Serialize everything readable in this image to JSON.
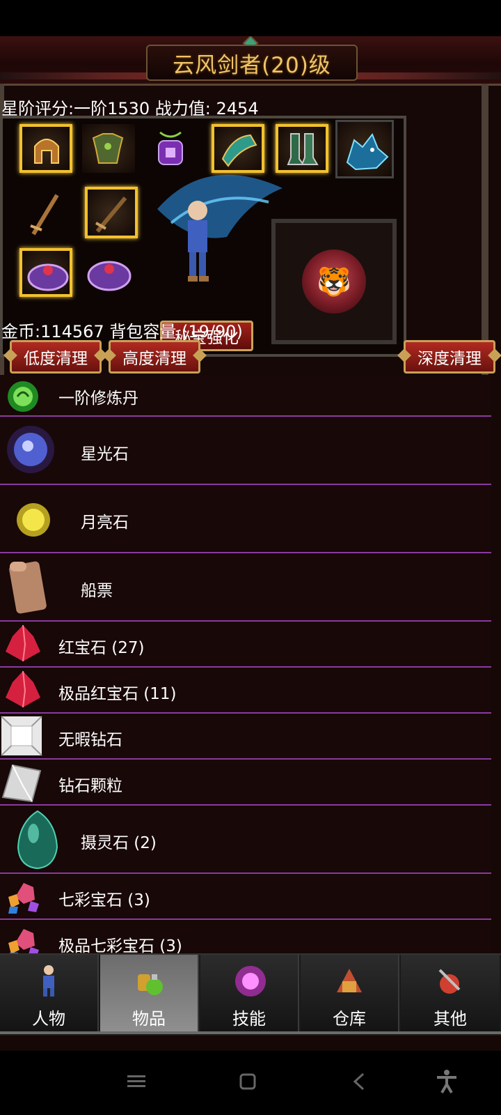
{
  "header": {
    "title": "云风剑者(20)级"
  },
  "stats": {
    "text": "星阶评分:一阶1530 战力值: 2454"
  },
  "equipment": {
    "treasure_button": "秘宝强化",
    "slots": [
      {
        "name": "helmet",
        "icon": "helmet-icon",
        "color": "#c77a2a"
      },
      {
        "name": "armor",
        "icon": "armor-icon",
        "color": "#5f7f3c"
      },
      {
        "name": "necklace",
        "icon": "amulet-icon",
        "color": "#9b3fd1"
      },
      {
        "name": "shoulder",
        "icon": "shoulder-icon",
        "color": "#2e9a8a"
      },
      {
        "name": "boots",
        "icon": "boots-icon",
        "color": "#3a7a56"
      },
      {
        "name": "pet",
        "icon": "wolf-icon",
        "color": "#3aa8d8"
      },
      {
        "name": "weapon-1",
        "icon": "sword-icon",
        "color": "#9a6a3a"
      },
      {
        "name": "weapon-2",
        "icon": "sword-icon",
        "color": "#8a6030"
      },
      {
        "name": "ring-1",
        "icon": "ring-icon",
        "color": "#a85fd0"
      },
      {
        "name": "ring-2",
        "icon": "ring-icon",
        "color": "#9a55c4"
      }
    ]
  },
  "inventory": {
    "gold_line": "金币:114567 背包容量 (19/90)",
    "clean_buttons": {
      "low": "低度清理",
      "high": "高度清理",
      "deep": "深度清理"
    },
    "items": [
      {
        "label": "一阶修炼丹",
        "icon": "green-orb-icon",
        "color": "#4cc34c"
      },
      {
        "label": "星光石",
        "icon": "starlight-stone-icon",
        "color": "#6a7cf0"
      },
      {
        "label": "月亮石",
        "icon": "moonstone-icon",
        "color": "#e6d12a"
      },
      {
        "label": "船票",
        "icon": "scroll-icon",
        "color": "#b8876a"
      },
      {
        "label": "红宝石 (27)",
        "icon": "ruby-icon",
        "color": "#e0344a"
      },
      {
        "label": "极品红宝石 (11)",
        "icon": "ruby-icon",
        "color": "#e0344a"
      },
      {
        "label": "无暇钻石",
        "icon": "diamond-icon",
        "color": "#d8d8d8"
      },
      {
        "label": "钻石颗粒",
        "icon": "diamond-shard-icon",
        "color": "#cfcfcf"
      },
      {
        "label": "摄灵石 (2)",
        "icon": "soul-stone-icon",
        "color": "#2aa58a"
      },
      {
        "label": "七彩宝石 (3)",
        "icon": "rainbow-gem-icon",
        "color": "#e0507a"
      },
      {
        "label": "极品七彩宝石 (3)",
        "icon": "rainbow-gem-icon",
        "color": "#e0507a"
      }
    ]
  },
  "tabs": [
    {
      "label": "人物",
      "icon": "character-icon",
      "active": false
    },
    {
      "label": "物品",
      "icon": "potion-icon",
      "active": true
    },
    {
      "label": "技能",
      "icon": "skill-icon",
      "active": false
    },
    {
      "label": "仓库",
      "icon": "warehouse-icon",
      "active": false
    },
    {
      "label": "其他",
      "icon": "other-icon",
      "active": false
    }
  ]
}
